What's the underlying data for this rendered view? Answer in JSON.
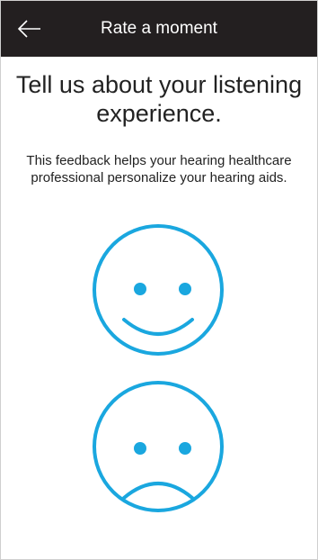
{
  "appbar": {
    "back_icon": "arrow-left-icon",
    "title": "Rate a moment"
  },
  "main": {
    "heading": "Tell us about your listening experience.",
    "subtext": "This feedback helps your hearing healthcare professional personalize your hearing aids."
  },
  "ratings": [
    {
      "icon": "happy-face-icon"
    },
    {
      "icon": "sad-face-icon"
    }
  ],
  "colors": {
    "appbar_bg": "#231f20",
    "accent": "#1aa7df",
    "text": "#222222"
  }
}
